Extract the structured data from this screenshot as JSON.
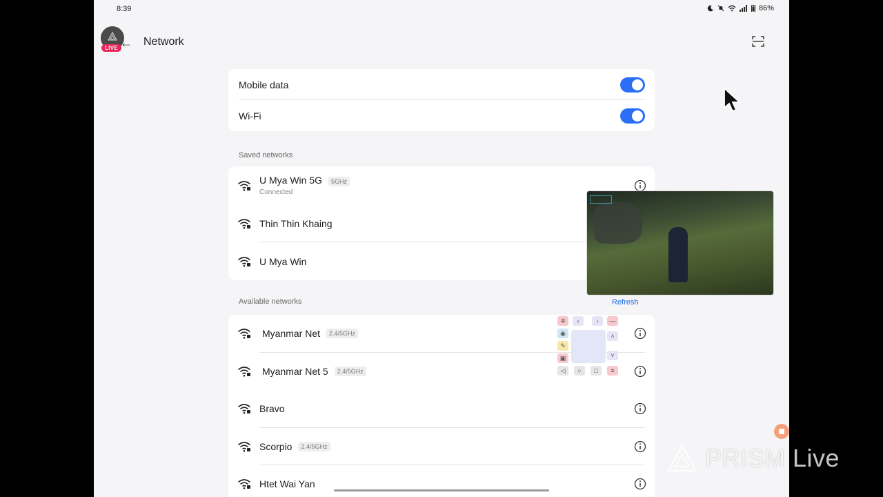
{
  "status_bar": {
    "time": "8:39",
    "battery": "86%"
  },
  "header": {
    "title": "Network",
    "live_badge": "LIVE"
  },
  "toggles": [
    {
      "label": "Mobile data",
      "on": true
    },
    {
      "label": "Wi-Fi",
      "on": true
    }
  ],
  "saved": {
    "label": "Saved networks",
    "items": [
      {
        "name": "U Mya Win 5G",
        "band": "5GHz",
        "status": "Connected"
      },
      {
        "name": "Thin Thin Khaing"
      },
      {
        "name": "U Mya Win"
      }
    ]
  },
  "available": {
    "label": "Available networks",
    "refresh": "Refresh",
    "items": [
      {
        "name": "Myanmar Net",
        "band": "2.4/5GHz"
      },
      {
        "name": "Myanmar Net 5",
        "band": "2.4/5GHz"
      },
      {
        "name": "Bravo"
      },
      {
        "name": "Scorpio",
        "band": "2.4/5GHz"
      },
      {
        "name": "Htet Wai Yan"
      }
    ]
  },
  "watermark": {
    "text": "PRISM Live"
  },
  "colors": {
    "accent": "#2a6ff5",
    "link": "#1a68d8",
    "live": "#e8245a"
  }
}
